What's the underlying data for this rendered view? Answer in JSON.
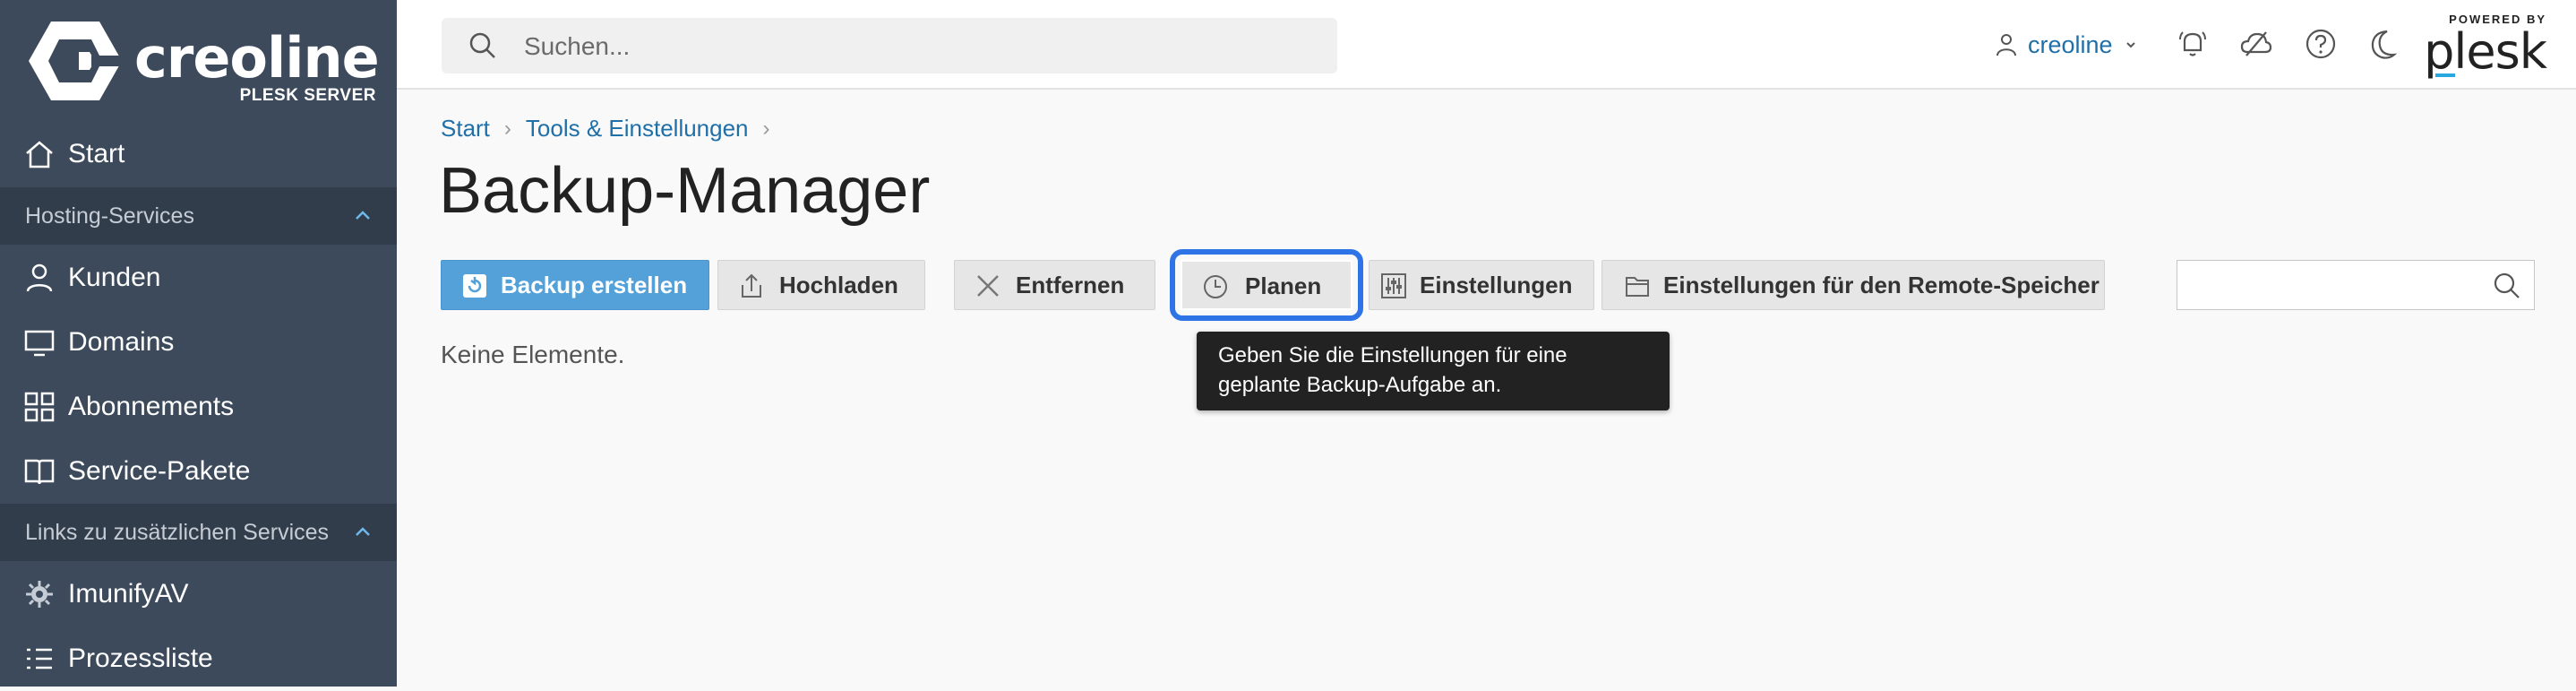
{
  "brand": {
    "name": "creoline",
    "sub": "PLESK SERVER"
  },
  "sidebar": {
    "start": "Start",
    "sections": [
      {
        "label": "Hosting-Services",
        "items": [
          "Kunden",
          "Domains",
          "Abonnements",
          "Service-Pakete"
        ]
      },
      {
        "label": "Links zu zusätzlichen Services",
        "items": [
          "ImunifyAV",
          "Prozessliste"
        ]
      }
    ]
  },
  "topbar": {
    "search_placeholder": "Suchen...",
    "user": "creoline",
    "powered_by": "POWERED BY",
    "plesk": "plesk"
  },
  "breadcrumb": [
    "Start",
    "Tools & Einstellungen"
  ],
  "page_title": "Backup-Manager",
  "toolbar": {
    "backup_create": "Backup erstellen",
    "upload": "Hochladen",
    "remove": "Entfernen",
    "schedule": "Planen",
    "settings": "Einstellungen",
    "remote_settings": "Einstellungen für den Remote-Speicher"
  },
  "empty_text": "Keine Elemente.",
  "tooltip": "Geben Sie die Einstellungen für eine geplante Backup-Aufgabe an.",
  "colors": {
    "sidebar": "#3c4a5b",
    "primary": "#53a1d8",
    "link": "#1f6fa8",
    "focus": "#2f74e6"
  }
}
